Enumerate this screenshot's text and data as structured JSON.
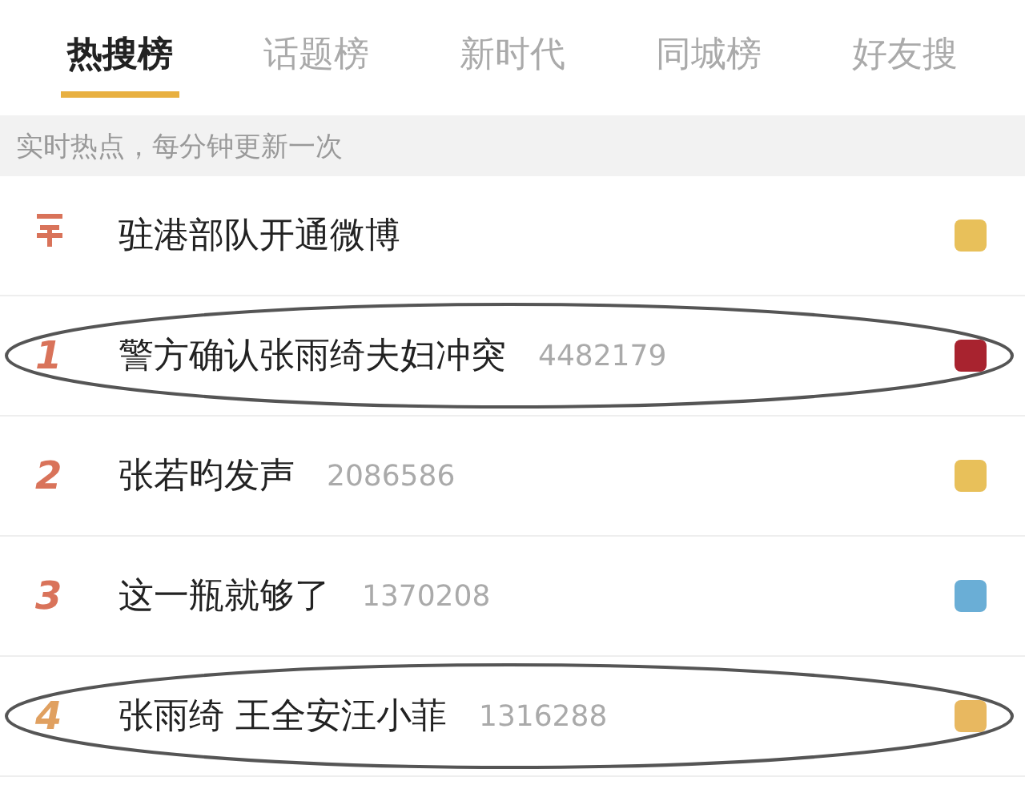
{
  "tabs": [
    {
      "label": "热搜榜",
      "selected": true
    },
    {
      "label": "话题榜",
      "selected": false
    },
    {
      "label": "新时代",
      "selected": false
    },
    {
      "label": "同城榜",
      "selected": false
    },
    {
      "label": "好友搜",
      "selected": false
    }
  ],
  "notice": "实时热点，每分钟更新一次",
  "rows": [
    {
      "kind": "pinned",
      "title": "驻港部队开通微博",
      "color": "#e8c05a",
      "circled": false
    },
    {
      "kind": "ranked",
      "rank": "1",
      "title": "警方确认张雨绮夫妇冲突",
      "count": "4482179",
      "color": "#a8232f",
      "circled": true
    },
    {
      "kind": "ranked",
      "rank": "2",
      "title": "张若昀发声",
      "count": "2086586",
      "color": "#e8c05a",
      "circled": false
    },
    {
      "kind": "ranked",
      "rank": "3",
      "title": "这一瓶就够了",
      "count": "1370208",
      "color": "#6aaed6",
      "circled": false
    },
    {
      "kind": "ranked",
      "rank": "4",
      "title": "张雨绮 王全安汪小菲",
      "count": "1316288",
      "color": "#e8b860",
      "circled": true
    }
  ]
}
